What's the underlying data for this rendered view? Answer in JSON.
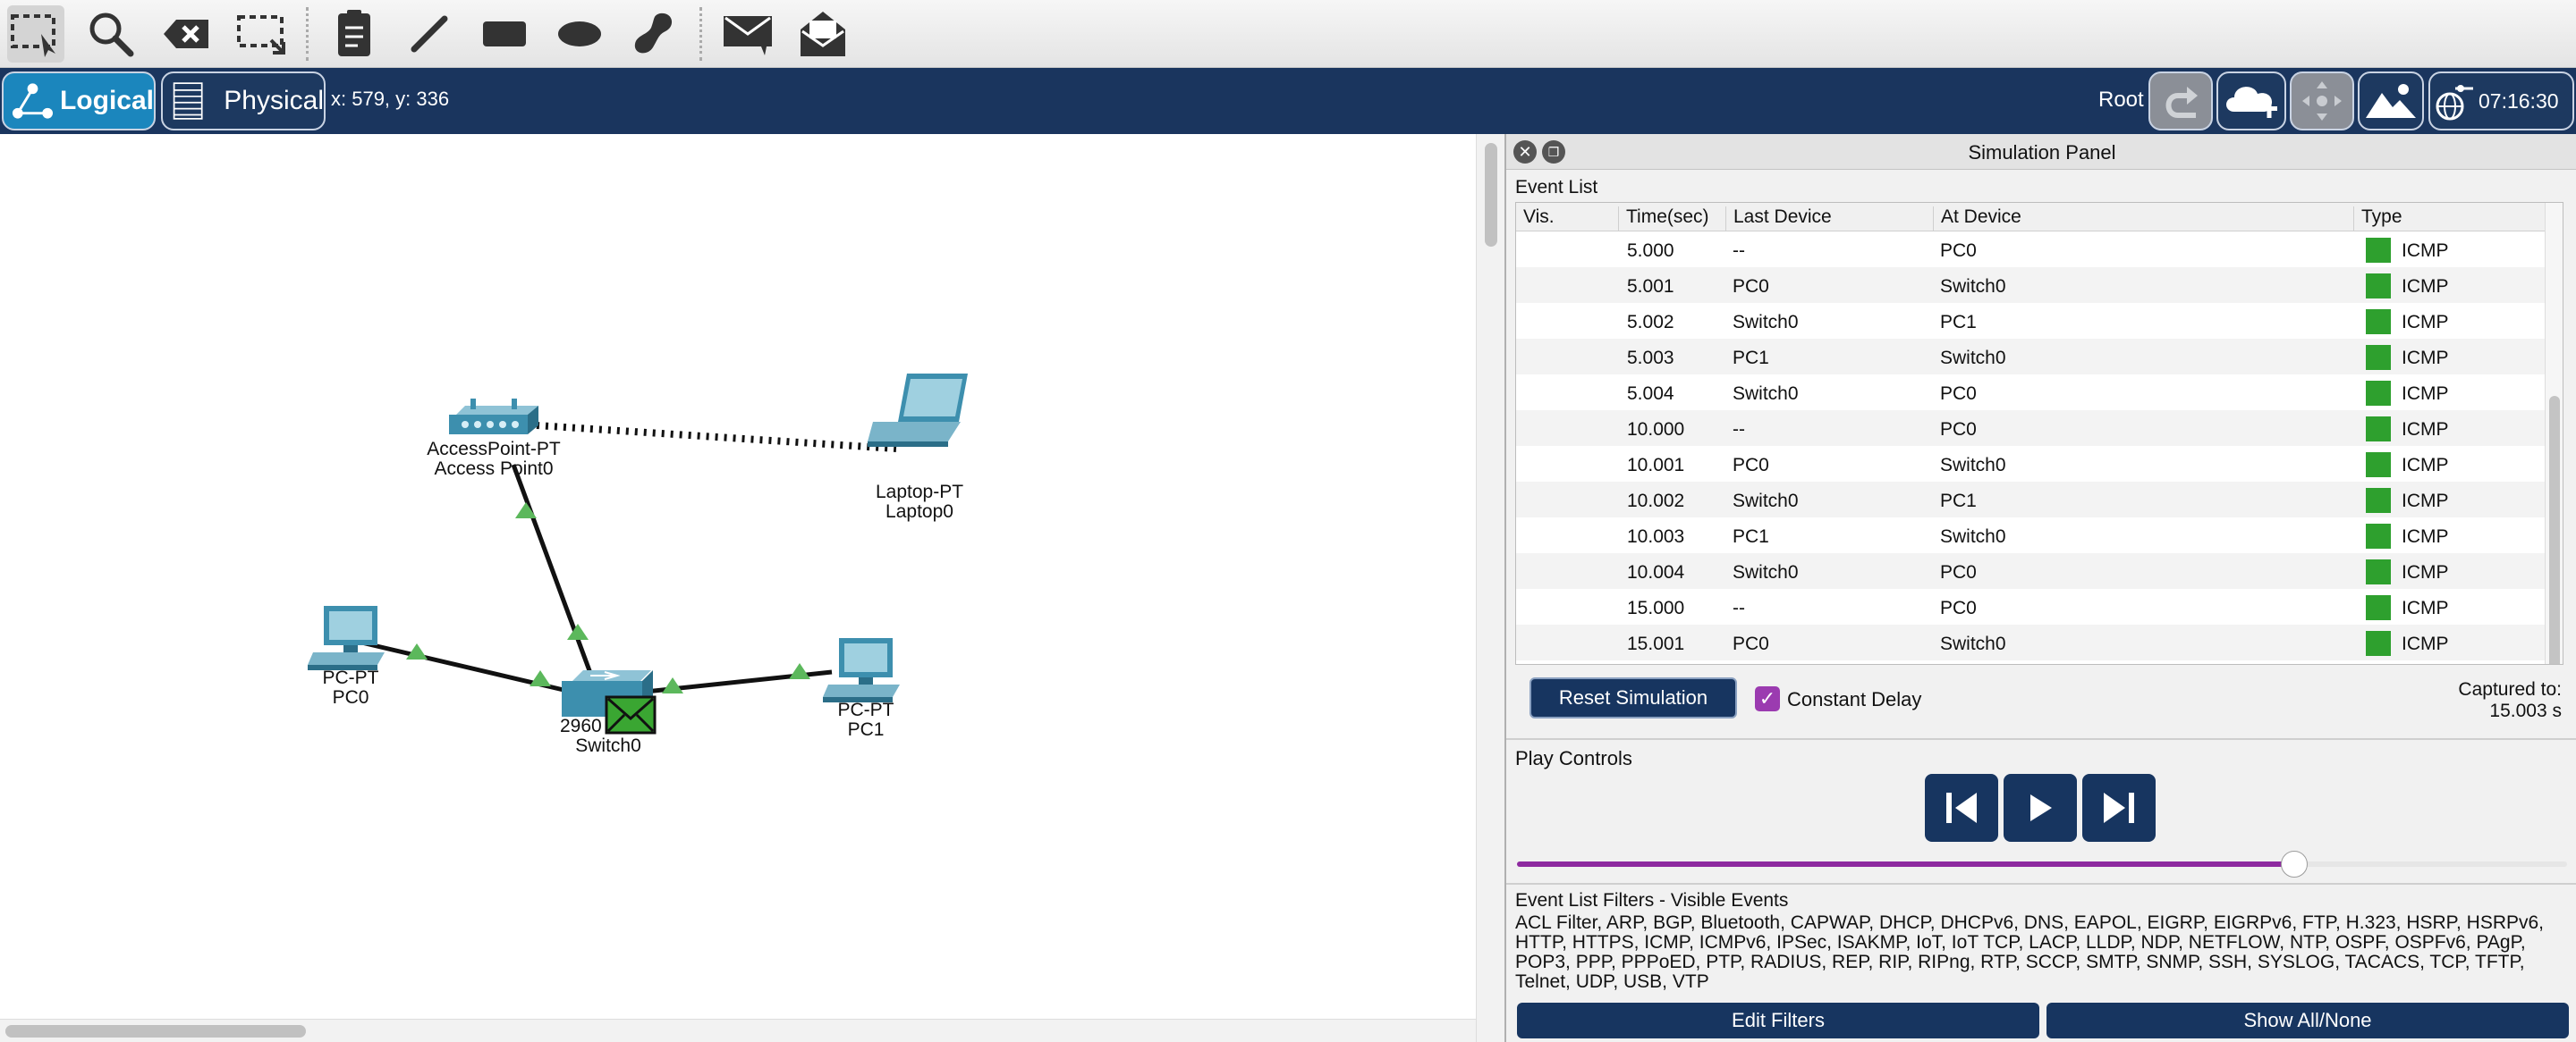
{
  "toolbar": {
    "icons": [
      "select-icon",
      "zoom-icon",
      "delete-icon",
      "resize-icon",
      "note-icon",
      "draw-line-icon",
      "rectangle-icon",
      "ellipse-icon",
      "freeform-icon",
      "simple-pdu-icon",
      "complex-pdu-icon"
    ]
  },
  "viewbar": {
    "logical_label": "Logical",
    "physical_label": "Physical",
    "coords": "x: 579, y: 336",
    "root_label": "Root",
    "clock": "07:16:30"
  },
  "devices": {
    "access_point": {
      "model": "AccessPoint-PT",
      "name": "Access Point0"
    },
    "laptop": {
      "model": "Laptop-PT",
      "name": "Laptop0"
    },
    "pc0": {
      "model": "PC-PT",
      "name": "PC0"
    },
    "pc1": {
      "model": "PC-PT",
      "name": "PC1"
    },
    "switch": {
      "model": "2960",
      "name": "Switch0"
    }
  },
  "sim_panel": {
    "title": "Simulation Panel",
    "event_list_label": "Event List",
    "columns": [
      "Vis.",
      "Time(sec)",
      "Last Device",
      "At Device",
      "Type"
    ],
    "events": [
      {
        "time": "5.000",
        "last": "--",
        "at": "PC0",
        "type": "ICMP"
      },
      {
        "time": "5.001",
        "last": "PC0",
        "at": "Switch0",
        "type": "ICMP"
      },
      {
        "time": "5.002",
        "last": "Switch0",
        "at": "PC1",
        "type": "ICMP"
      },
      {
        "time": "5.003",
        "last": "PC1",
        "at": "Switch0",
        "type": "ICMP"
      },
      {
        "time": "5.004",
        "last": "Switch0",
        "at": "PC0",
        "type": "ICMP"
      },
      {
        "time": "10.000",
        "last": "--",
        "at": "PC0",
        "type": "ICMP"
      },
      {
        "time": "10.001",
        "last": "PC0",
        "at": "Switch0",
        "type": "ICMP"
      },
      {
        "time": "10.002",
        "last": "Switch0",
        "at": "PC1",
        "type": "ICMP"
      },
      {
        "time": "10.003",
        "last": "PC1",
        "at": "Switch0",
        "type": "ICMP"
      },
      {
        "time": "10.004",
        "last": "Switch0",
        "at": "PC0",
        "type": "ICMP"
      },
      {
        "time": "15.000",
        "last": "--",
        "at": "PC0",
        "type": "ICMP"
      },
      {
        "time": "15.001",
        "last": "PC0",
        "at": "Switch0",
        "type": "ICMP"
      }
    ],
    "event_color": "#2ea02e",
    "reset_label": "Reset Simulation",
    "constant_delay_label": "Constant Delay",
    "constant_delay_checked": true,
    "captured_label": "Captured to:",
    "captured_value": "15.003 s",
    "play_controls_label": "Play Controls",
    "play_progress": 0.74,
    "filters_label": "Event List Filters - Visible Events",
    "filters_text": "ACL Filter, ARP, BGP, Bluetooth, CAPWAP, DHCP, DHCPv6, DNS, EAPOL, EIGRP, EIGRPv6, FTP, H.323, HSRP, HSRPv6, HTTP, HTTPS, ICMP, ICMPv6, IPSec, ISAKMP, IoT, IoT TCP, LACP, LLDP, NDP, NETFLOW, NTP, OSPF, OSPFv6, PAgP, POP3, PPP, PPPoED, PTP, RADIUS, REP, RIP, RIPng, RTP, SCCP, SMTP, SNMP, SSH, SYSLOG, TACACS, TCP, TFTP, Telnet, UDP, USB, VTP",
    "edit_filters_label": "Edit Filters",
    "show_all_label": "Show All/None"
  }
}
